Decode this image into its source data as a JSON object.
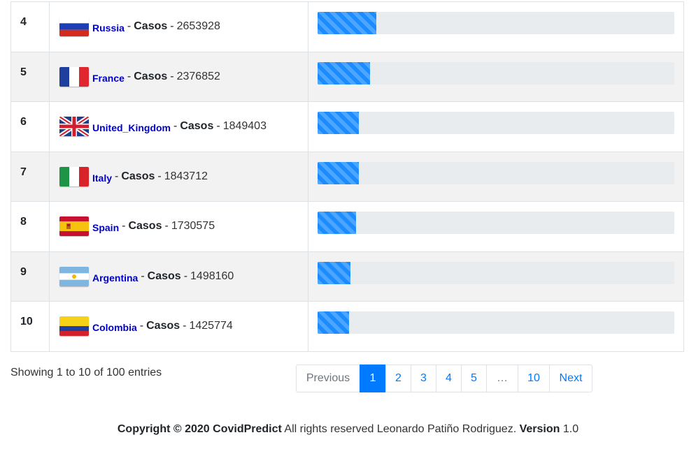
{
  "rows": [
    {
      "rank": "4",
      "country": "Russia",
      "casos_label": "Casos",
      "value": "2653928",
      "progress": 0.165,
      "flag": "russia-flag"
    },
    {
      "rank": "5",
      "country": "France",
      "casos_label": "Casos",
      "value": "2376852",
      "progress": 0.148,
      "flag": "france-flag"
    },
    {
      "rank": "6",
      "country": "United_Kingdom",
      "casos_label": "Casos",
      "value": "1849403",
      "progress": 0.115,
      "flag": "united-kingdom-flag"
    },
    {
      "rank": "7",
      "country": "Italy",
      "casos_label": "Casos",
      "value": "1843712",
      "progress": 0.115,
      "flag": "italy-flag"
    },
    {
      "rank": "8",
      "country": "Spain",
      "casos_label": "Casos",
      "value": "1730575",
      "progress": 0.108,
      "flag": "spain-flag"
    },
    {
      "rank": "9",
      "country": "Argentina",
      "casos_label": "Casos",
      "value": "1498160",
      "progress": 0.093,
      "flag": "argentina-flag"
    },
    {
      "rank": "10",
      "country": "Colombia",
      "casos_label": "Casos",
      "value": "1425774",
      "progress": 0.089,
      "flag": "colombia-flag"
    }
  ],
  "separator": "-",
  "table_info": "Showing 1 to 10 of 100 entries",
  "pagination": {
    "previous": "Previous",
    "pages": [
      "1",
      "2",
      "3",
      "4",
      "5"
    ],
    "ellipsis": "…",
    "last": "10",
    "next": "Next",
    "active": "1"
  },
  "footer": {
    "copyright": "Copyright © 2020 CovidPredict",
    "rights": "All rights reserved Leonardo Patiño Rodriguez.",
    "version_label": "Version",
    "version": "1.0"
  },
  "colors": {
    "bar": "#1a8cff",
    "link": "#007bff",
    "country_link": "#0000cc"
  }
}
